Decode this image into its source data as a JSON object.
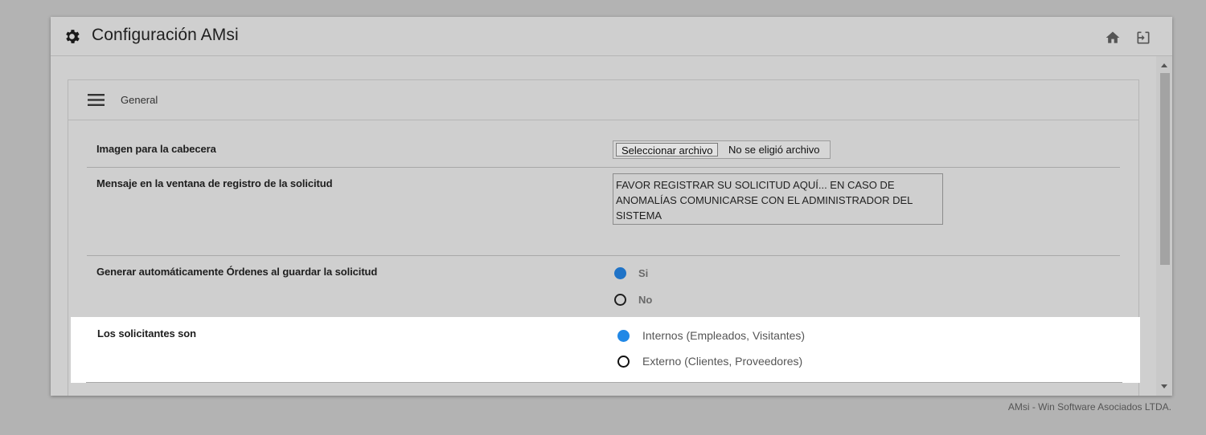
{
  "header": {
    "title": "Configuración AMsi",
    "icons": [
      "gear-icon",
      "home-icon",
      "exit-icon"
    ]
  },
  "panel": {
    "title": "General",
    "menu_icon": "hamburger-menu-icon"
  },
  "settings": {
    "header_image": {
      "label": "Imagen para la cabecera",
      "button_label": "Seleccionar archivo",
      "status": "No se eligió archivo"
    },
    "message": {
      "label": "Mensaje en la ventana de registro de la solicitud",
      "value": "FAVOR REGISTRAR SU SOLICITUD AQUÍ... EN CASO DE ANOMALÍAS COMUNICARSE CON EL ADMINISTRADOR DEL SISTEMA"
    },
    "auto_orders": {
      "label": "Generar automáticamente Órdenes al guardar la solicitud",
      "options": [
        "Si",
        "No"
      ],
      "selected": "Si"
    },
    "requesters": {
      "label": "Los solicitantes son",
      "options": [
        "Internos (Empleados, Visitantes)",
        "Externo (Clientes, Proveedores)"
      ],
      "selected": "Internos (Empleados, Visitantes)"
    }
  },
  "footer": {
    "text": "AMsi - Win Software Asociados LTDA."
  },
  "colors": {
    "background": "#b3b3b3",
    "window": "#cfcfcf",
    "radio_selected": "#1f73c7",
    "highlight": "#ffffff"
  }
}
